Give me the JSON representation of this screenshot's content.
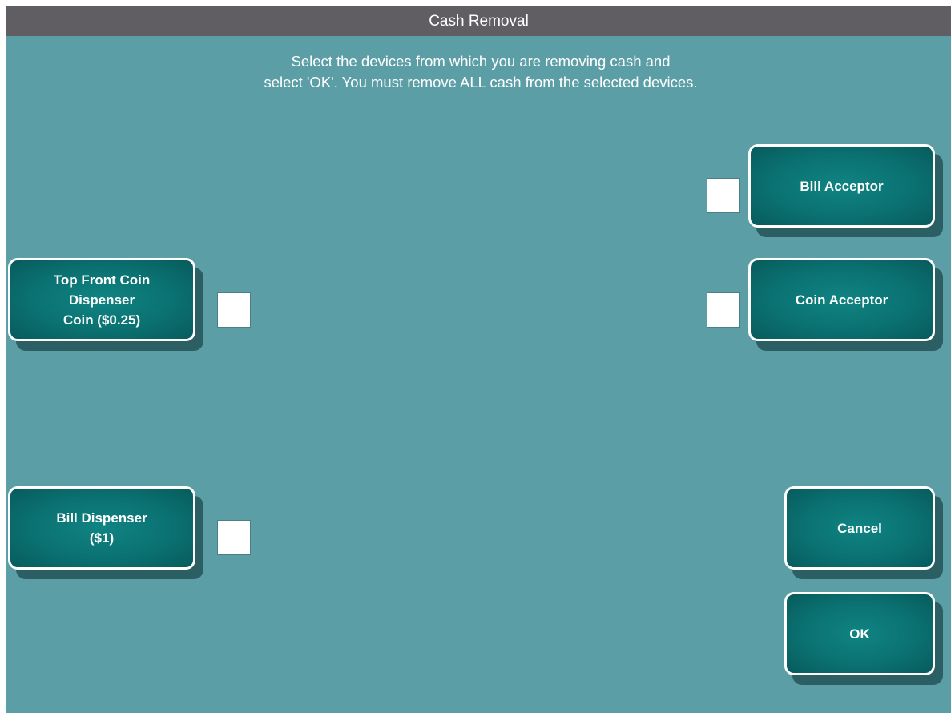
{
  "window": {
    "title": "Cash Removal"
  },
  "instructions": {
    "line1": "Select the devices from which you are removing cash and",
    "line2": "select 'OK'.  You must remove ALL cash from the selected devices."
  },
  "devices": {
    "bill_acceptor": {
      "label": "Bill Acceptor",
      "checked": false
    },
    "coin_acceptor": {
      "label": "Coin Acceptor",
      "checked": false
    },
    "top_front_coin_dispenser": {
      "line1": "Top Front Coin",
      "line2": "Dispenser",
      "line3": "Coin ($0.25)",
      "checked": false
    },
    "bill_dispenser": {
      "line1": "Bill Dispenser",
      "line2": "($1)",
      "checked": false
    }
  },
  "actions": {
    "cancel_label": "Cancel",
    "ok_label": "OK"
  },
  "colors": {
    "background": "#5b9ea6",
    "titlebar": "#605e62",
    "button": "#0b7171",
    "button_shadow": "#2b5f64"
  }
}
